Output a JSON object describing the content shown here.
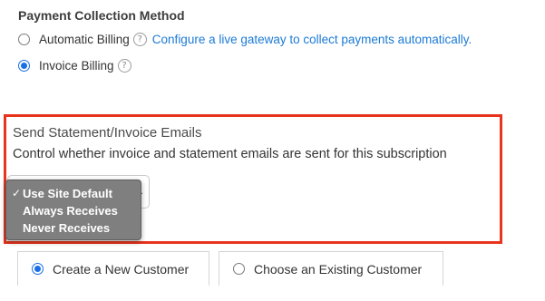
{
  "payment": {
    "heading": "Payment Collection Method",
    "options": [
      {
        "label": "Automatic Billing",
        "selected": false,
        "link": "Configure a live gateway to collect payments automatically."
      },
      {
        "label": "Invoice Billing",
        "selected": true
      }
    ],
    "help_glyph": "?"
  },
  "emails": {
    "heading": "Send Statement/Invoice Emails",
    "description": "Control whether invoice and statement emails are sent for this subscription",
    "selected": "Use Site Default",
    "options": [
      "Use Site Default",
      "Always Receives",
      "Never Receives"
    ],
    "check_glyph": "✓",
    "arrow_glyph": "⌄",
    "highlight_color": "#e8341c"
  },
  "customer_tabs": [
    {
      "label": "Create a New Customer",
      "selected": true
    },
    {
      "label": "Choose an Existing Customer",
      "selected": false
    }
  ],
  "colors": {
    "link": "#1b7ad6",
    "radio_selected": "#1a6ee6",
    "menu_bg": "#7f7f7f"
  }
}
